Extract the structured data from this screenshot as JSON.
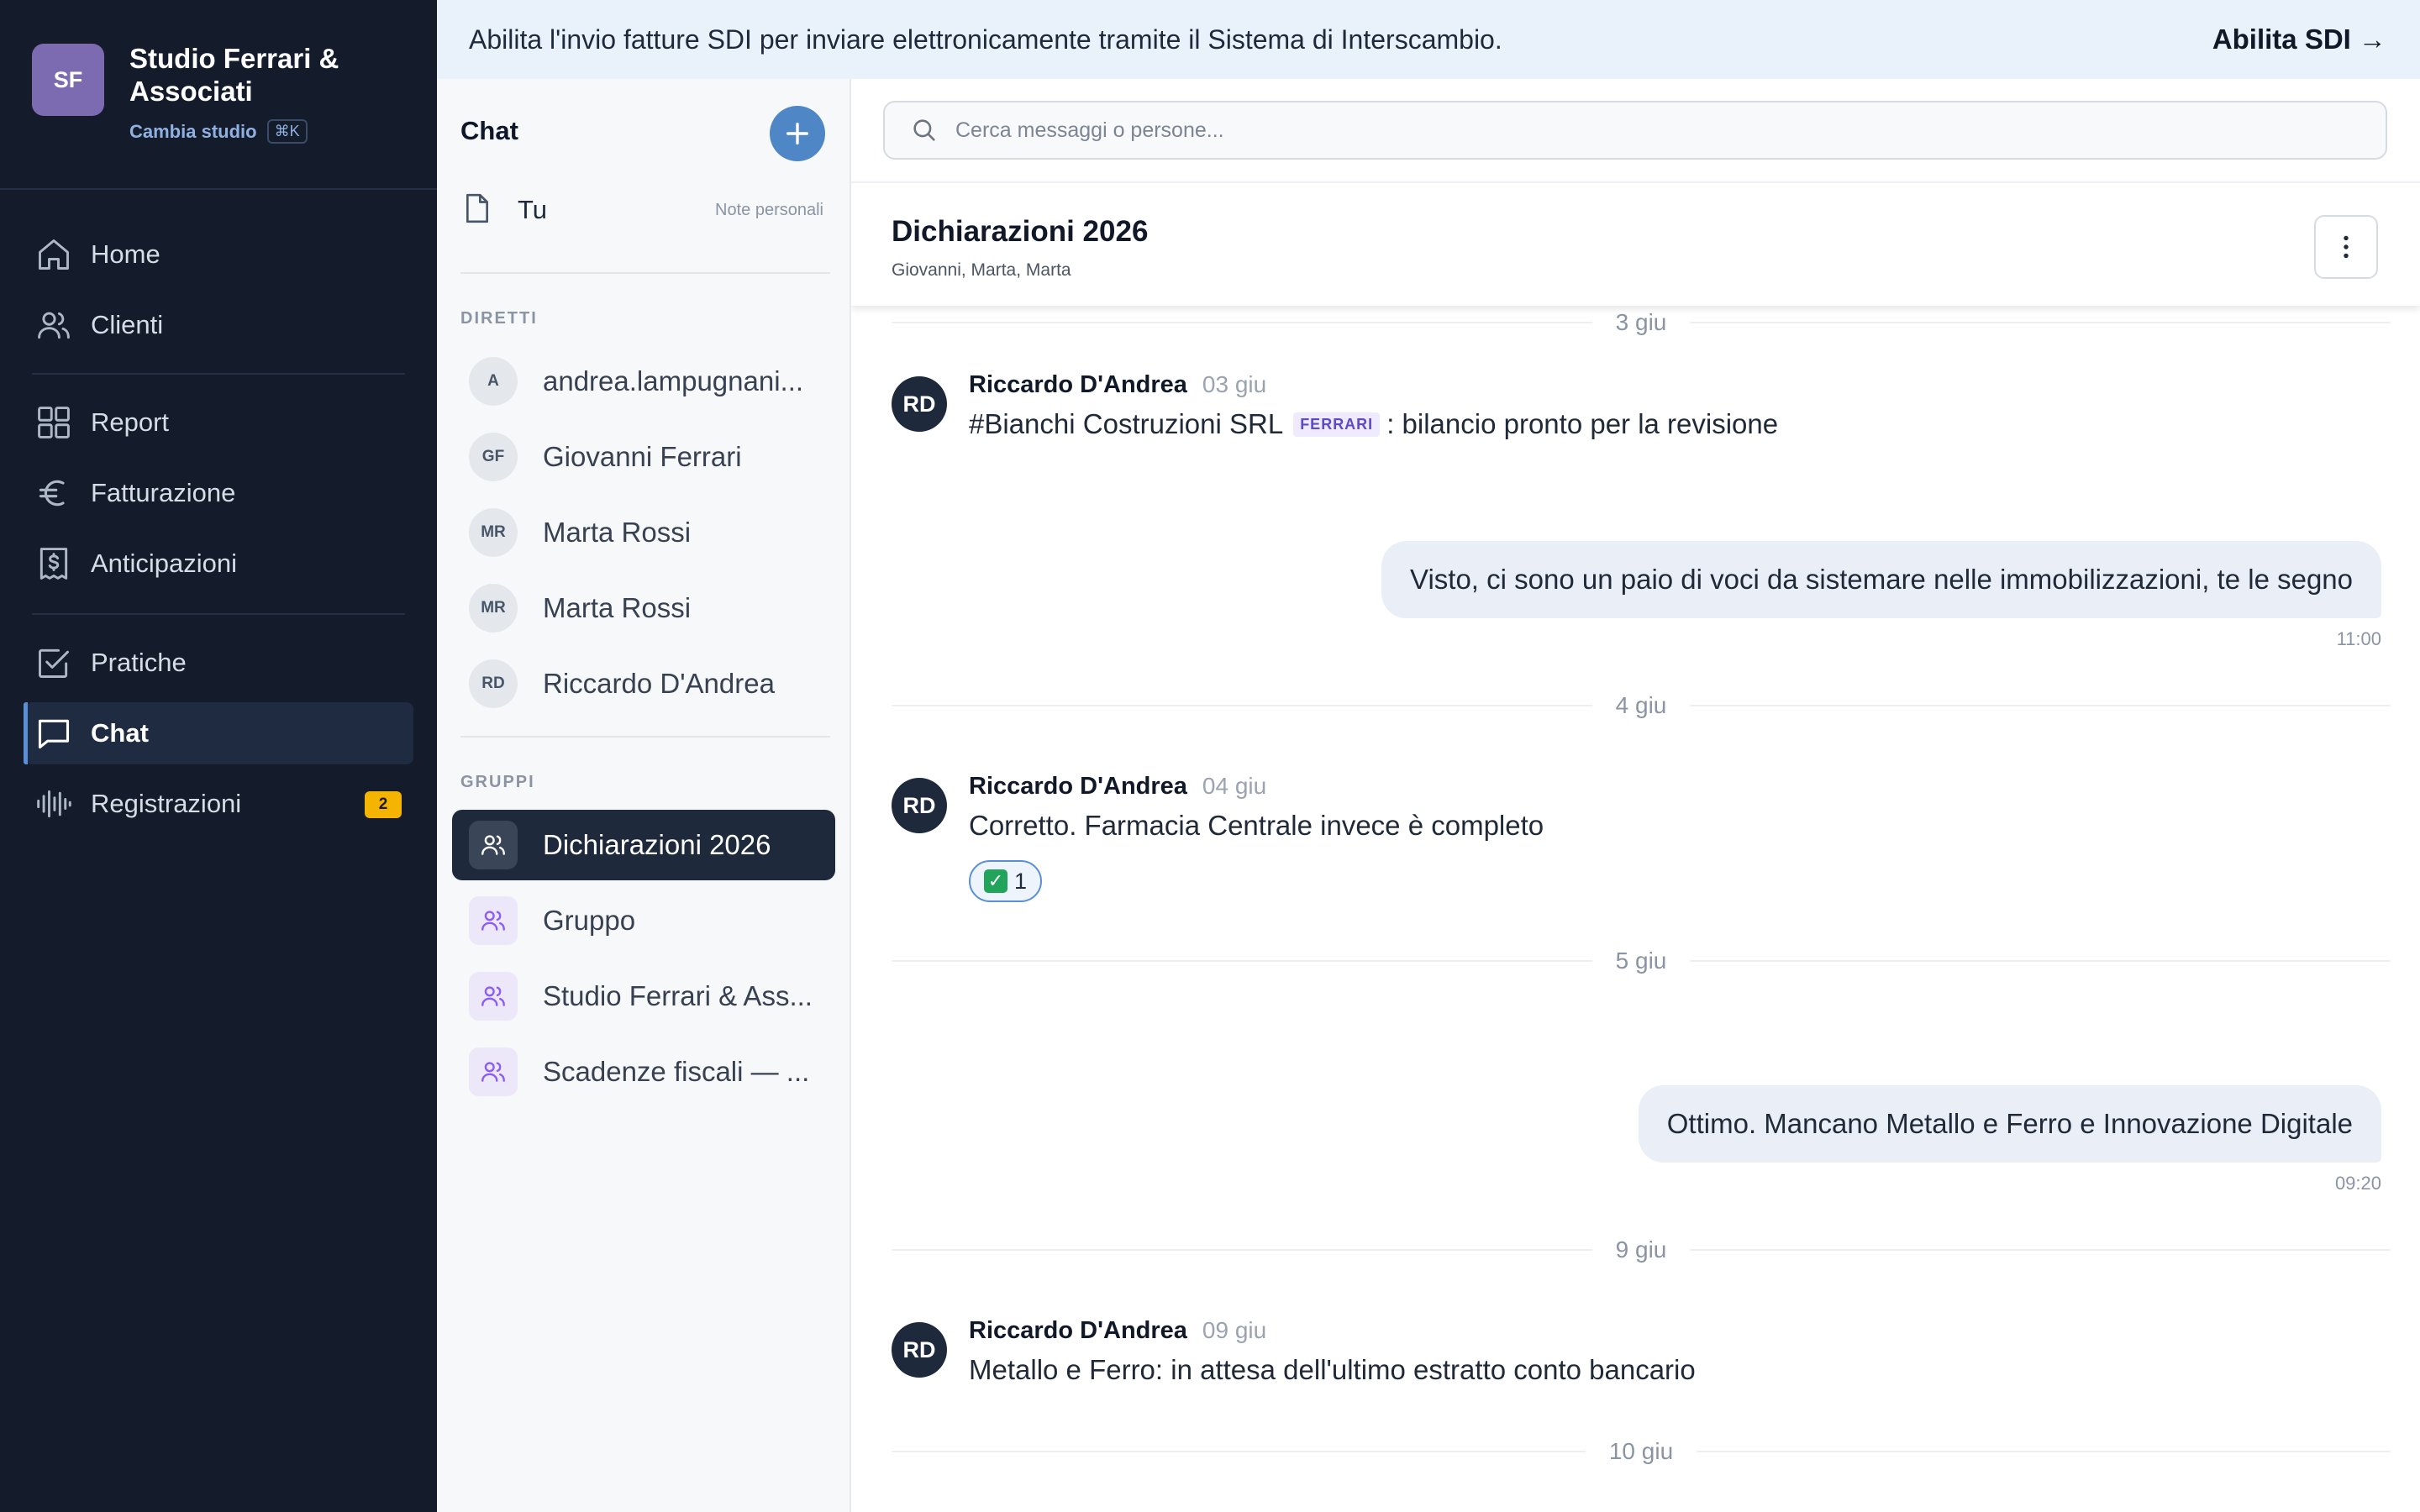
{
  "banner": {
    "text": "Abilita l'invio fatture SDI per inviare elettronicamente tramite il Sistema di Interscambio.",
    "action": "Abilita SDI →"
  },
  "studio": {
    "initials": "SF",
    "name": "Studio Ferrari & Associati",
    "switch_label": "Cambia studio",
    "shortcut": "⌘K",
    "logo_color": "#7c6bb0"
  },
  "nav": {
    "home": "Home",
    "clienti": "Clienti",
    "report": "Report",
    "fatturazione": "Fatturazione",
    "anticipazioni": "Anticipazioni",
    "pratiche": "Pratiche",
    "chat": "Chat",
    "registrazioni": "Registrazioni",
    "registrazioni_badge": "2",
    "active": "chat"
  },
  "chatlist": {
    "title": "Chat",
    "self": {
      "name": "Tu",
      "note": "Note personali"
    },
    "direct_label": "DIRETTI",
    "direct": [
      {
        "initials": "A",
        "name": "andrea.lampugnani..."
      },
      {
        "initials": "GF",
        "name": "Giovanni Ferrari"
      },
      {
        "initials": "MR",
        "name": "Marta Rossi"
      },
      {
        "initials": "MR",
        "name": "Marta Rossi"
      },
      {
        "initials": "RD",
        "name": "Riccardo D'Andrea"
      }
    ],
    "groups_label": "GRUPPI",
    "groups": [
      {
        "name": "Dichiarazioni 2026",
        "active": true
      },
      {
        "name": "Gruppo"
      },
      {
        "name": "Studio Ferrari & Ass..."
      },
      {
        "name": "Scadenze fiscali — ..."
      }
    ]
  },
  "search": {
    "placeholder": "Cerca messaggi o persone..."
  },
  "conversation": {
    "title": "Dichiarazioni 2026",
    "members": "Giovanni, Marta, Marta",
    "top_date_partial": "3 giu",
    "messages": [
      {
        "author": "Riccardo D'Andrea",
        "initials": "RD",
        "time": "03 giu",
        "mention": "#Bianchi Costruzioni SRL",
        "tag": "FERRARI",
        "text": ": bilancio pronto per la revisione"
      },
      {
        "outgoing": true,
        "text": "Visto, ci sono un paio di voci da sistemare nelle immobilizzazioni, te le segno",
        "time": "11:00"
      },
      {
        "date": "4 giu"
      },
      {
        "author": "Riccardo D'Andrea",
        "initials": "RD",
        "time": "04 giu",
        "text": "Corretto. Farmacia Centrale invece è completo",
        "reaction": {
          "emoji": "✓",
          "count": "1"
        }
      },
      {
        "date": "5 giu"
      },
      {
        "outgoing": true,
        "text": "Ottimo. Mancano Metallo e Ferro e Innovazione Digitale",
        "time": "09:20"
      },
      {
        "date": "9 giu"
      },
      {
        "author": "Riccardo D'Andrea",
        "initials": "RD",
        "time": "09 giu",
        "text": "Metallo e Ferro: in attesa dell'ultimo estratto conto bancario"
      },
      {
        "date": "10 giu"
      }
    ]
  },
  "colors": {
    "sidebar_bg": "#141c2c",
    "accent": "#4f86c6",
    "active_contact_bg": "#1e293b",
    "badge": "#f5b400"
  }
}
